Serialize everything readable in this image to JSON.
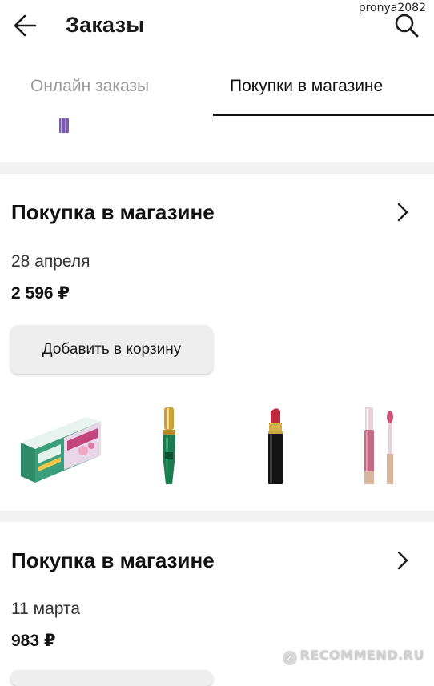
{
  "watermark_user": "pronya2082",
  "header": {
    "title": "Заказы",
    "back_icon": "arrow-left-icon",
    "search_icon": "search-icon"
  },
  "tabs": [
    {
      "label": "Онлайн заказы",
      "active": false
    },
    {
      "label": "Покупки в магазине",
      "active": true
    }
  ],
  "orders": [
    {
      "title": "Покупка в магазине",
      "date": "28 апреля",
      "sum": "2 596 ₽",
      "button_label": "Добавить в корзину",
      "products": [
        "toothpaste-himalaya-image",
        "mascara-green-image",
        "lipstick-red-image",
        "lip-gloss-pink-image"
      ]
    },
    {
      "title": "Покупка в магазине",
      "date": "11 марта",
      "sum": "983 ₽"
    }
  ],
  "watermark_site": "RECOMMEND.RU",
  "colors": {
    "background": "#ffffff",
    "separator": "#f2f2f2",
    "button_bg": "#eeeeee",
    "inactive_tab": "#9a9a9a",
    "active_underline": "#111111"
  }
}
